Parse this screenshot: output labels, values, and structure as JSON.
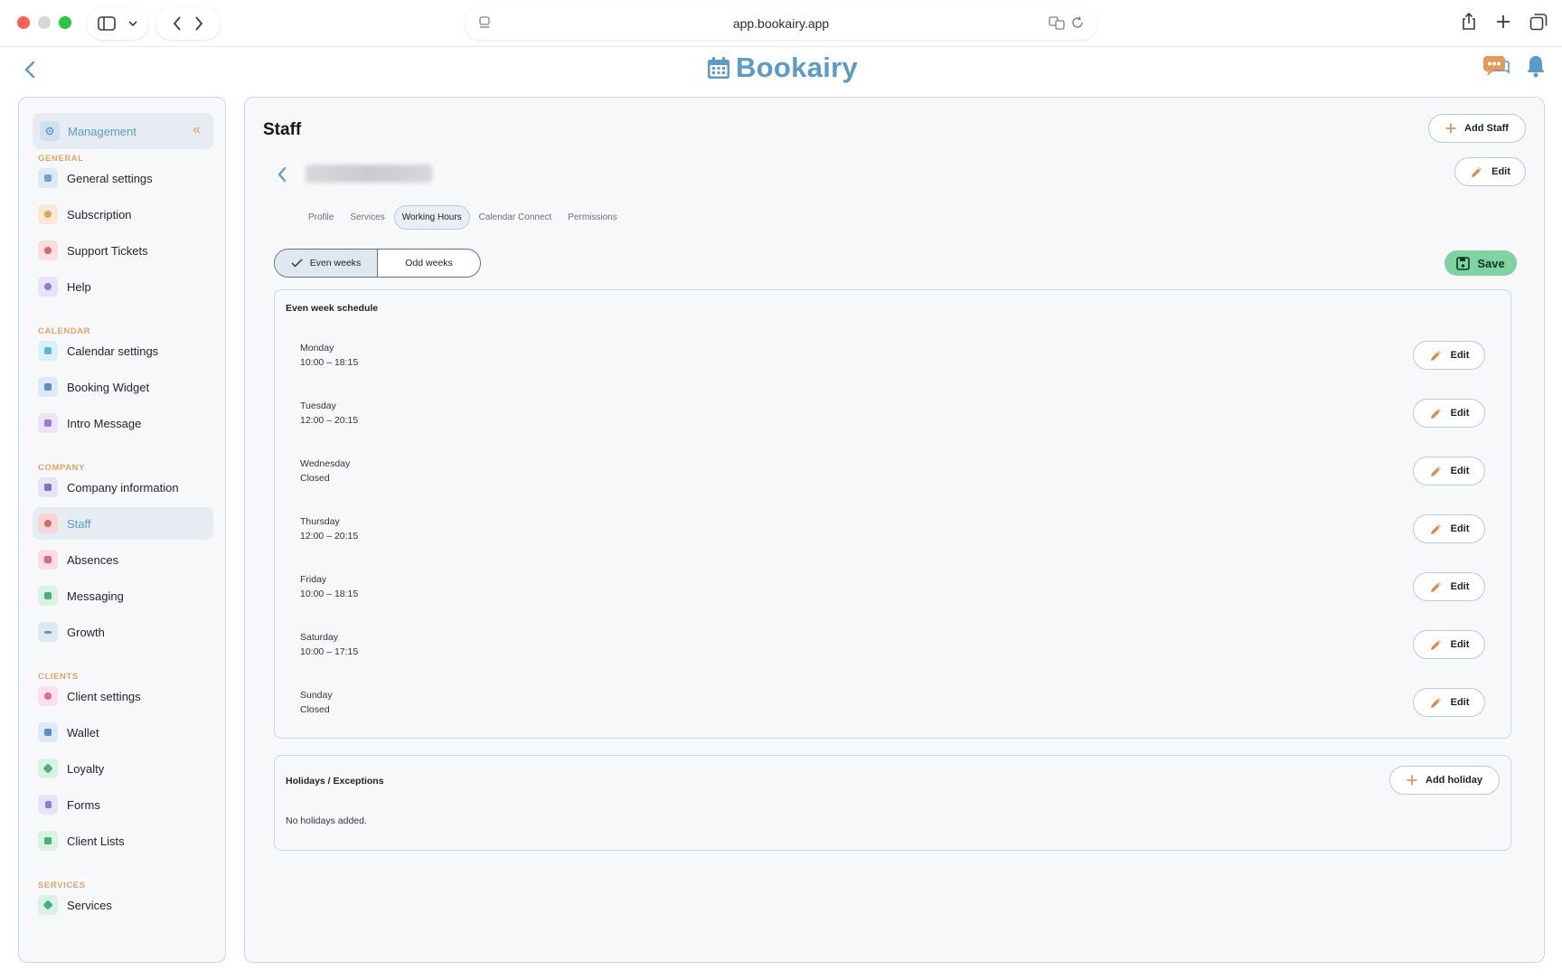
{
  "browser": {
    "url": "app.bookairy.app"
  },
  "header": {
    "logo_text": "Bookairy",
    "brand_color": "#5a9cc4"
  },
  "sidebar": {
    "management_label": "Management",
    "collapse_glyph": "«",
    "sections": {
      "general": "GENERAL",
      "calendar": "CALENDAR",
      "company": "COMPANY",
      "clients": "CLIENTS",
      "services": "SERVICES"
    },
    "items": [
      {
        "label": "General settings",
        "icon": "sliders-icon"
      },
      {
        "label": "Subscription",
        "icon": "badge-icon"
      },
      {
        "label": "Support Tickets",
        "icon": "lifebuoy-icon"
      },
      {
        "label": "Help",
        "icon": "help-icon"
      },
      {
        "label": "Calendar settings",
        "icon": "calendar-icon"
      },
      {
        "label": "Booking Widget",
        "icon": "widget-icon"
      },
      {
        "label": "Intro Message",
        "icon": "message-icon"
      },
      {
        "label": "Company information",
        "icon": "building-icon"
      },
      {
        "label": "Staff",
        "icon": "users-icon",
        "active": true
      },
      {
        "label": "Absences",
        "icon": "calendar-x-icon"
      },
      {
        "label": "Messaging",
        "icon": "chat-icon"
      },
      {
        "label": "Growth",
        "icon": "trend-icon"
      },
      {
        "label": "Client settings",
        "icon": "user-icon"
      },
      {
        "label": "Wallet",
        "icon": "wallet-icon"
      },
      {
        "label": "Loyalty",
        "icon": "tag-icon"
      },
      {
        "label": "Forms",
        "icon": "document-icon"
      },
      {
        "label": "Client Lists",
        "icon": "list-icon"
      },
      {
        "label": "Services",
        "icon": "gem-icon"
      }
    ]
  },
  "main": {
    "title": "Staff",
    "add_staff_label": "Add Staff",
    "edit_label": "Edit",
    "tabs": [
      {
        "label": "Profile"
      },
      {
        "label": "Services"
      },
      {
        "label": "Working Hours",
        "active": true
      },
      {
        "label": "Calendar Connect"
      },
      {
        "label": "Permissions"
      }
    ],
    "week_toggle": {
      "even": "Even weeks",
      "odd": "Odd weeks",
      "selected": "even"
    },
    "save_label": "Save",
    "schedule": {
      "title": "Even week schedule",
      "days": [
        {
          "name": "Monday",
          "hours": "10:00 – 18:15"
        },
        {
          "name": "Tuesday",
          "hours": "12:00 – 20:15"
        },
        {
          "name": "Wednesday",
          "hours": "Closed"
        },
        {
          "name": "Thursday",
          "hours": "12:00 – 20:15"
        },
        {
          "name": "Friday",
          "hours": "10:00 – 18:15"
        },
        {
          "name": "Saturday",
          "hours": "10:00 – 17:15"
        },
        {
          "name": "Sunday",
          "hours": "Closed"
        }
      ],
      "row_edit_label": "Edit"
    },
    "holidays": {
      "title": "Holidays / Exceptions",
      "add_label": "Add holiday",
      "empty_text": "No holidays added."
    }
  }
}
